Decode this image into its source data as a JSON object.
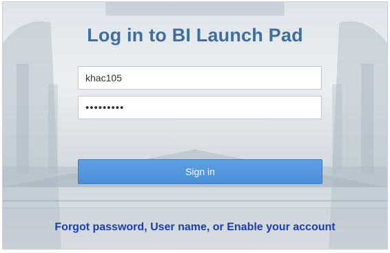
{
  "login": {
    "title": "Log in to BI Launch Pad",
    "username_value": "khac105",
    "password_value": "khac105pw",
    "signin_label": "Sign in",
    "forgot_link": "Forgot password, User name, or Enable your account"
  },
  "colors": {
    "title": "#3f6e9d",
    "button": "#4a8ed6",
    "link": "#1a3fb0"
  }
}
